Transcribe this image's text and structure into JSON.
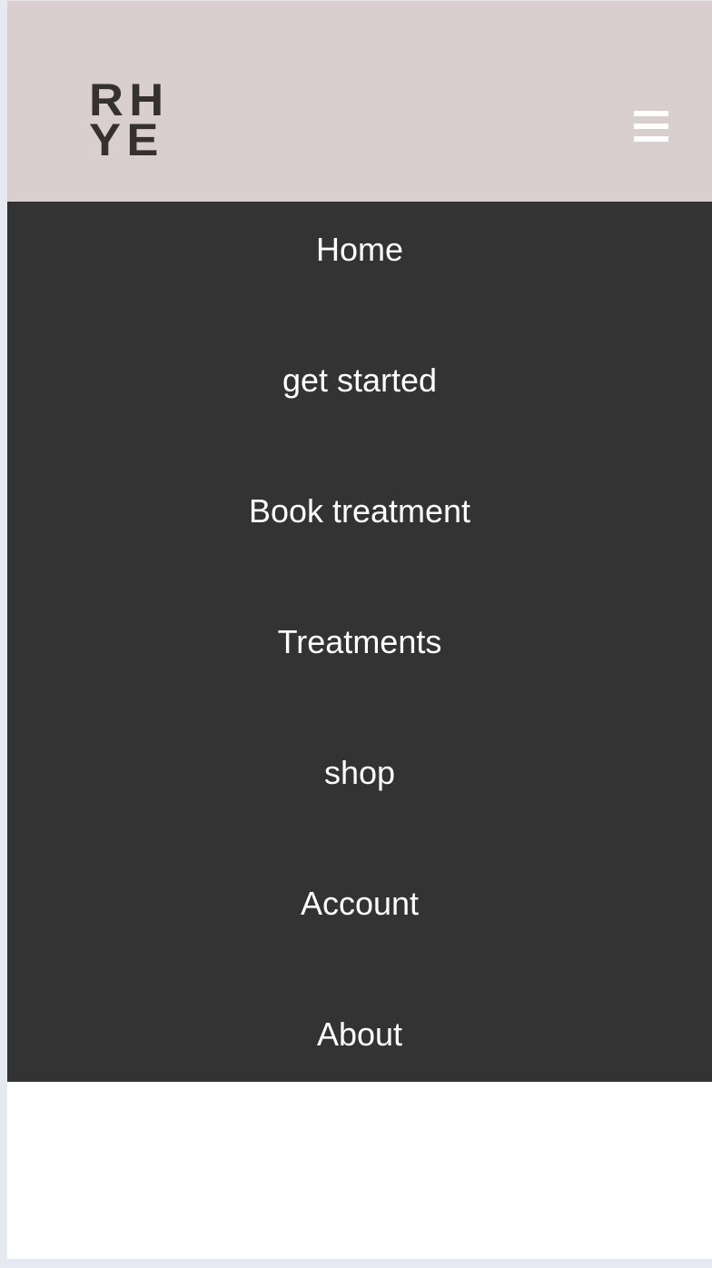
{
  "brand": {
    "logo_line1": "RH",
    "logo_line2": "YE",
    "logo_text": "RHYE"
  },
  "menu": {
    "icon": "hamburger-icon"
  },
  "nav": {
    "items": [
      {
        "label": "Home"
      },
      {
        "label": "get started"
      },
      {
        "label": "Book treatment"
      },
      {
        "label": "Treatments"
      },
      {
        "label": "shop"
      },
      {
        "label": "Account"
      },
      {
        "label": "About"
      }
    ]
  },
  "colors": {
    "header_bg": "#d9cfcf",
    "nav_bg": "#333333",
    "nav_text": "#ffffff",
    "logo": "#35312e"
  }
}
